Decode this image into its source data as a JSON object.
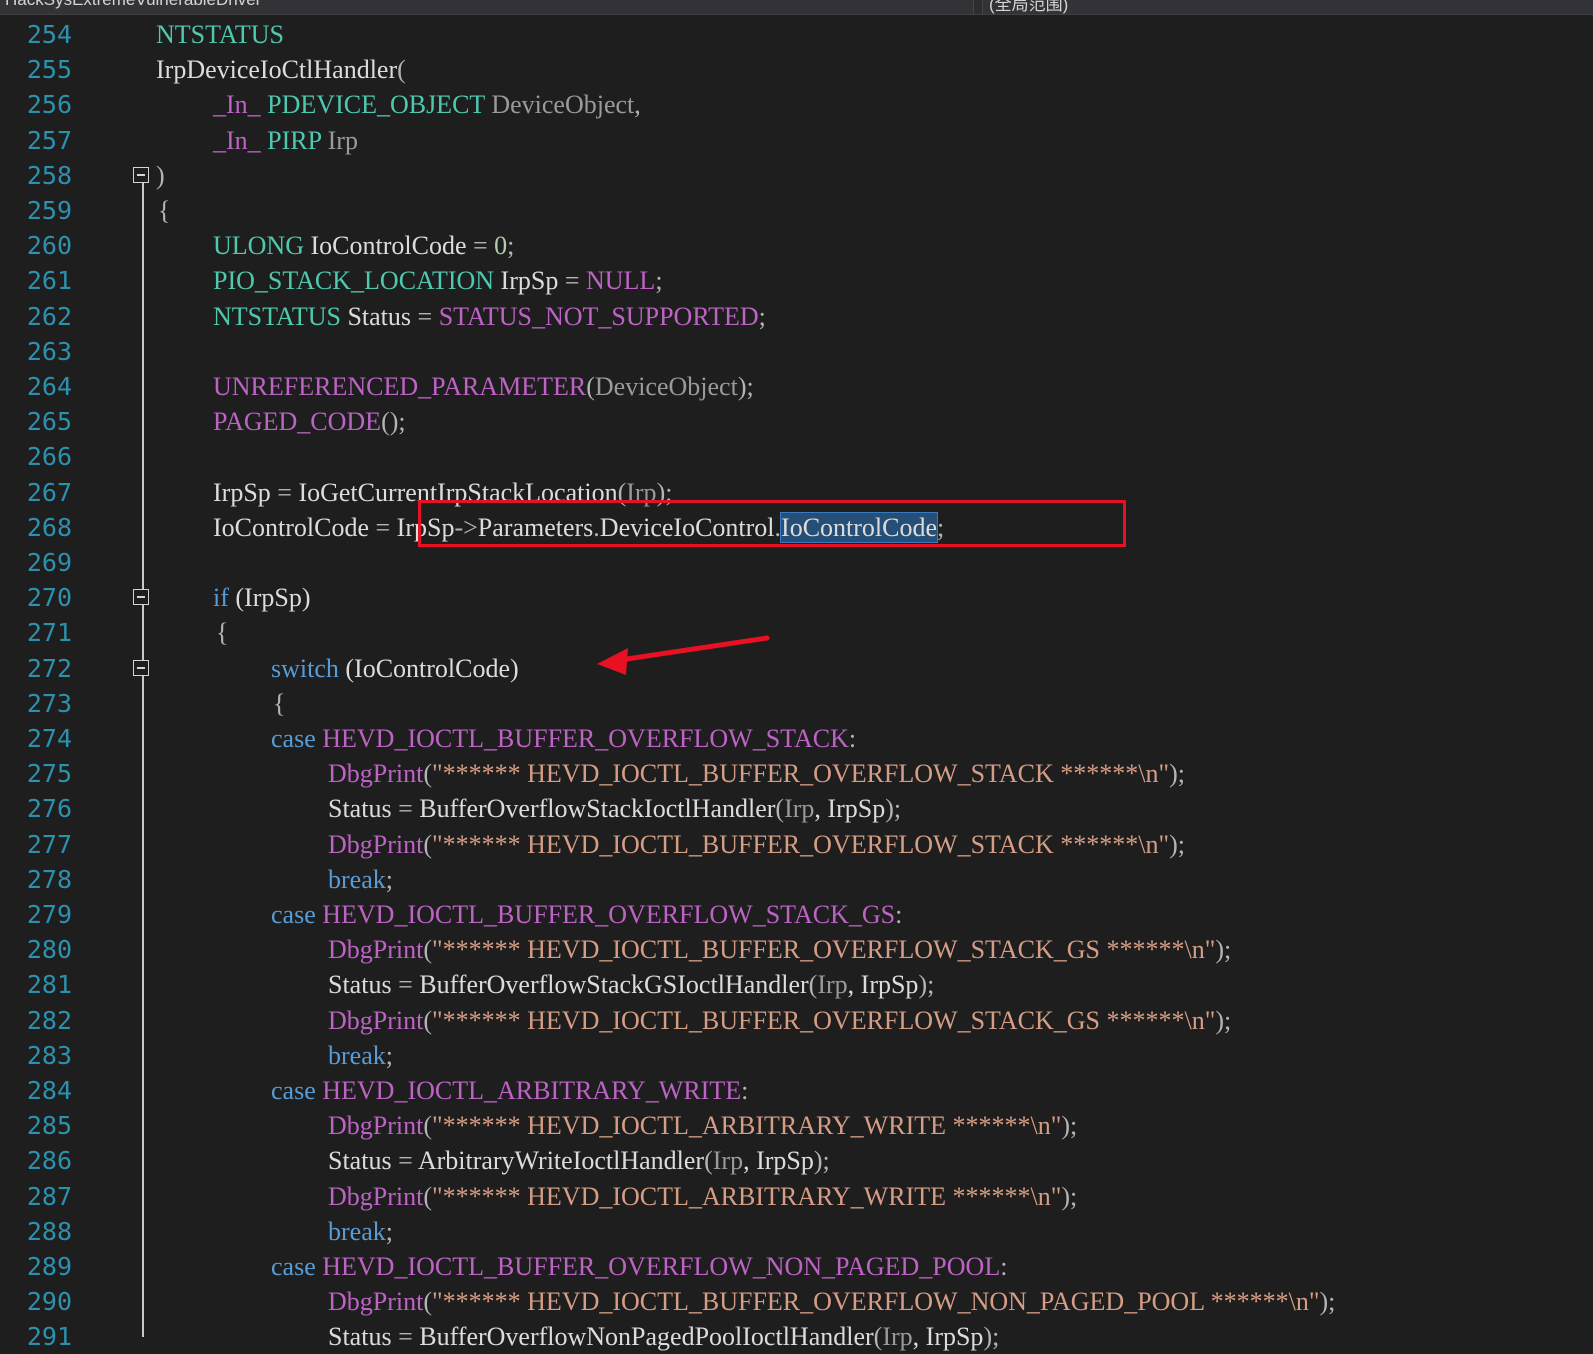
{
  "tabs": {
    "file_nav": "HackSysExtremeVulnerableDriver",
    "scope_nav": "(全局范围)"
  },
  "colors": {
    "background": "#1e1e1e",
    "line_number": "#2b91af",
    "keyword": "#569cd6",
    "type": "#4ec9b0",
    "macro": "#bd63c5",
    "parameter": "#9a9a9a",
    "string": "#d69d85",
    "number": "#b5cea8",
    "annotation": "#e81123",
    "selection": "#264f78"
  },
  "editor": {
    "lines": [
      {
        "n": "254",
        "tokens": [
          {
            "t": "NTSTATUS",
            "c": "type"
          }
        ]
      },
      {
        "n": "255",
        "tokens": [
          {
            "t": "IrpDeviceIoCtlHandler",
            "c": "id"
          },
          {
            "t": "(",
            "c": "punc"
          }
        ]
      },
      {
        "n": "256",
        "tokens": [
          {
            "t": "_In_",
            "c": "macro"
          },
          {
            "t": " ",
            "c": "id"
          },
          {
            "t": "PDEVICE_OBJECT",
            "c": "type"
          },
          {
            "t": " ",
            "c": "id"
          },
          {
            "t": "DeviceObject",
            "c": "param"
          },
          {
            "t": ",",
            "c": "punc"
          }
        ]
      },
      {
        "n": "257",
        "tokens": [
          {
            "t": "_In_",
            "c": "macro"
          },
          {
            "t": " ",
            "c": "id"
          },
          {
            "t": "PIRP",
            "c": "type"
          },
          {
            "t": " ",
            "c": "id"
          },
          {
            "t": "Irp",
            "c": "param"
          }
        ]
      },
      {
        "n": "258",
        "tokens": [
          {
            "t": ")",
            "c": "punc"
          }
        ]
      },
      {
        "n": "259",
        "tokens": [
          {
            "t": "{",
            "c": "punc"
          }
        ]
      },
      {
        "n": "260",
        "tokens": [
          {
            "t": "ULONG",
            "c": "type"
          },
          {
            "t": " IoControlCode ",
            "c": "id"
          },
          {
            "t": "=",
            "c": "punc"
          },
          {
            "t": " ",
            "c": "id"
          },
          {
            "t": "0",
            "c": "num"
          },
          {
            "t": ";",
            "c": "punc"
          }
        ]
      },
      {
        "n": "261",
        "tokens": [
          {
            "t": "PIO_STACK_LOCATION",
            "c": "type"
          },
          {
            "t": " IrpSp ",
            "c": "id"
          },
          {
            "t": "=",
            "c": "punc"
          },
          {
            "t": " ",
            "c": "id"
          },
          {
            "t": "NULL",
            "c": "macro"
          },
          {
            "t": ";",
            "c": "punc"
          }
        ]
      },
      {
        "n": "262",
        "tokens": [
          {
            "t": "NTSTATUS",
            "c": "type"
          },
          {
            "t": " Status ",
            "c": "id"
          },
          {
            "t": "=",
            "c": "punc"
          },
          {
            "t": " ",
            "c": "id"
          },
          {
            "t": "STATUS_NOT_SUPPORTED",
            "c": "macro"
          },
          {
            "t": ";",
            "c": "punc"
          }
        ]
      },
      {
        "n": "263",
        "tokens": []
      },
      {
        "n": "264",
        "tokens": [
          {
            "t": "UNREFERENCED_PARAMETER",
            "c": "macro"
          },
          {
            "t": "(",
            "c": "punc"
          },
          {
            "t": "DeviceObject",
            "c": "param"
          },
          {
            "t": ");",
            "c": "punc"
          }
        ]
      },
      {
        "n": "265",
        "tokens": [
          {
            "t": "PAGED_CODE",
            "c": "macro"
          },
          {
            "t": "();",
            "c": "punc"
          }
        ]
      },
      {
        "n": "266",
        "tokens": []
      },
      {
        "n": "267",
        "tokens": [
          {
            "t": "IrpSp ",
            "c": "id"
          },
          {
            "t": "=",
            "c": "punc"
          },
          {
            "t": " IoGetCurrentIrpStackLocation",
            "c": "id"
          },
          {
            "t": "(",
            "c": "punc"
          },
          {
            "t": "Irp",
            "c": "param"
          },
          {
            "t": ");",
            "c": "punc"
          }
        ]
      },
      {
        "n": "268",
        "tokens": [
          {
            "t": "IoControlCode ",
            "c": "id"
          },
          {
            "t": "=",
            "c": "punc"
          },
          {
            "t": " IrpSp",
            "c": "id"
          },
          {
            "t": "->",
            "c": "punc"
          },
          {
            "t": "Parameters",
            "c": "id"
          },
          {
            "t": ".",
            "c": "punc"
          },
          {
            "t": "DeviceIoControl",
            "c": "id"
          },
          {
            "t": ".",
            "c": "punc"
          },
          {
            "t": "IoControlCode",
            "c": "hl"
          },
          {
            "t": ";",
            "c": "punc"
          }
        ]
      },
      {
        "n": "269",
        "tokens": []
      },
      {
        "n": "270",
        "tokens": [
          {
            "t": "if",
            "c": "kw"
          },
          {
            "t": " (IrpSp)",
            "c": "id"
          }
        ]
      },
      {
        "n": "271",
        "tokens": [
          {
            "t": "{",
            "c": "punc"
          }
        ]
      },
      {
        "n": "272",
        "tokens": [
          {
            "t": "switch",
            "c": "kw"
          },
          {
            "t": " (IoControlCode)",
            "c": "id"
          }
        ]
      },
      {
        "n": "273",
        "tokens": [
          {
            "t": "{",
            "c": "punc"
          }
        ]
      },
      {
        "n": "274",
        "tokens": [
          {
            "t": "case",
            "c": "kw"
          },
          {
            "t": " ",
            "c": "id"
          },
          {
            "t": "HEVD_IOCTL_BUFFER_OVERFLOW_STACK",
            "c": "macro"
          },
          {
            "t": ":",
            "c": "punc"
          }
        ]
      },
      {
        "n": "275",
        "tokens": [
          {
            "t": "DbgPrint",
            "c": "macro"
          },
          {
            "t": "(",
            "c": "punc"
          },
          {
            "t": "\"****** HEVD_IOCTL_BUFFER_OVERFLOW_STACK ******\\n\"",
            "c": "str"
          },
          {
            "t": ");",
            "c": "punc"
          }
        ]
      },
      {
        "n": "276",
        "tokens": [
          {
            "t": "Status ",
            "c": "id"
          },
          {
            "t": "=",
            "c": "punc"
          },
          {
            "t": " BufferOverflowStackIoctlHandler",
            "c": "id"
          },
          {
            "t": "(",
            "c": "punc"
          },
          {
            "t": "Irp",
            "c": "param"
          },
          {
            "t": ", IrpSp",
            "c": "id"
          },
          {
            "t": ");",
            "c": "punc"
          }
        ]
      },
      {
        "n": "277",
        "tokens": [
          {
            "t": "DbgPrint",
            "c": "macro"
          },
          {
            "t": "(",
            "c": "punc"
          },
          {
            "t": "\"****** HEVD_IOCTL_BUFFER_OVERFLOW_STACK ******\\n\"",
            "c": "str"
          },
          {
            "t": ");",
            "c": "punc"
          }
        ]
      },
      {
        "n": "278",
        "tokens": [
          {
            "t": "break",
            "c": "kw"
          },
          {
            "t": ";",
            "c": "punc"
          }
        ]
      },
      {
        "n": "279",
        "tokens": [
          {
            "t": "case",
            "c": "kw"
          },
          {
            "t": " ",
            "c": "id"
          },
          {
            "t": "HEVD_IOCTL_BUFFER_OVERFLOW_STACK_GS",
            "c": "macro"
          },
          {
            "t": ":",
            "c": "punc"
          }
        ]
      },
      {
        "n": "280",
        "tokens": [
          {
            "t": "DbgPrint",
            "c": "macro"
          },
          {
            "t": "(",
            "c": "punc"
          },
          {
            "t": "\"****** HEVD_IOCTL_BUFFER_OVERFLOW_STACK_GS ******\\n\"",
            "c": "str"
          },
          {
            "t": ");",
            "c": "punc"
          }
        ]
      },
      {
        "n": "281",
        "tokens": [
          {
            "t": "Status ",
            "c": "id"
          },
          {
            "t": "=",
            "c": "punc"
          },
          {
            "t": " BufferOverflowStackGSIoctlHandler",
            "c": "id"
          },
          {
            "t": "(",
            "c": "punc"
          },
          {
            "t": "Irp",
            "c": "param"
          },
          {
            "t": ", IrpSp",
            "c": "id"
          },
          {
            "t": ");",
            "c": "punc"
          }
        ]
      },
      {
        "n": "282",
        "tokens": [
          {
            "t": "DbgPrint",
            "c": "macro"
          },
          {
            "t": "(",
            "c": "punc"
          },
          {
            "t": "\"****** HEVD_IOCTL_BUFFER_OVERFLOW_STACK_GS ******\\n\"",
            "c": "str"
          },
          {
            "t": ");",
            "c": "punc"
          }
        ]
      },
      {
        "n": "283",
        "tokens": [
          {
            "t": "break",
            "c": "kw"
          },
          {
            "t": ";",
            "c": "punc"
          }
        ]
      },
      {
        "n": "284",
        "tokens": [
          {
            "t": "case",
            "c": "kw"
          },
          {
            "t": " ",
            "c": "id"
          },
          {
            "t": "HEVD_IOCTL_ARBITRARY_WRITE",
            "c": "macro"
          },
          {
            "t": ":",
            "c": "punc"
          }
        ]
      },
      {
        "n": "285",
        "tokens": [
          {
            "t": "DbgPrint",
            "c": "macro"
          },
          {
            "t": "(",
            "c": "punc"
          },
          {
            "t": "\"****** HEVD_IOCTL_ARBITRARY_WRITE ******\\n\"",
            "c": "str"
          },
          {
            "t": ");",
            "c": "punc"
          }
        ]
      },
      {
        "n": "286",
        "tokens": [
          {
            "t": "Status ",
            "c": "id"
          },
          {
            "t": "=",
            "c": "punc"
          },
          {
            "t": " ArbitraryWriteIoctlHandler",
            "c": "id"
          },
          {
            "t": "(",
            "c": "punc"
          },
          {
            "t": "Irp",
            "c": "param"
          },
          {
            "t": ", IrpSp",
            "c": "id"
          },
          {
            "t": ");",
            "c": "punc"
          }
        ]
      },
      {
        "n": "287",
        "tokens": [
          {
            "t": "DbgPrint",
            "c": "macro"
          },
          {
            "t": "(",
            "c": "punc"
          },
          {
            "t": "\"****** HEVD_IOCTL_ARBITRARY_WRITE ******\\n\"",
            "c": "str"
          },
          {
            "t": ");",
            "c": "punc"
          }
        ]
      },
      {
        "n": "288",
        "tokens": [
          {
            "t": "break",
            "c": "kw"
          },
          {
            "t": ";",
            "c": "punc"
          }
        ]
      },
      {
        "n": "289",
        "tokens": [
          {
            "t": "case",
            "c": "kw"
          },
          {
            "t": " ",
            "c": "id"
          },
          {
            "t": "HEVD_IOCTL_BUFFER_OVERFLOW_NON_PAGED_POOL",
            "c": "macro"
          },
          {
            "t": ":",
            "c": "punc"
          }
        ]
      },
      {
        "n": "290",
        "tokens": [
          {
            "t": "DbgPrint",
            "c": "macro"
          },
          {
            "t": "(",
            "c": "punc"
          },
          {
            "t": "\"****** HEVD_IOCTL_BUFFER_OVERFLOW_NON_PAGED_POOL ******\\n\"",
            "c": "str"
          },
          {
            "t": ");",
            "c": "punc"
          }
        ]
      },
      {
        "n": "291",
        "tokens": [
          {
            "t": "Status ",
            "c": "id"
          },
          {
            "t": "=",
            "c": "punc"
          },
          {
            "t": " BufferOverflowNonPagedPoolIoctlHandler",
            "c": "id"
          },
          {
            "t": "(",
            "c": "punc"
          },
          {
            "t": "Irp",
            "c": "param"
          },
          {
            "t": ", IrpSp",
            "c": "id"
          },
          {
            "t": ");",
            "c": "punc"
          }
        ]
      }
    ]
  }
}
